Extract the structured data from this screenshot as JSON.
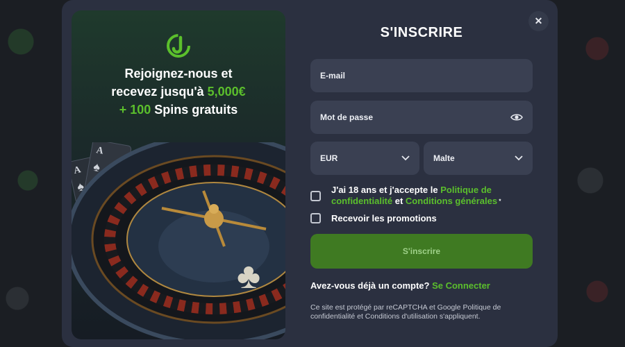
{
  "dialog": {
    "title": "S'INSCRIRE",
    "close_icon": "close-icon"
  },
  "promo": {
    "line1": "Rejoignez-nous et",
    "line2_prefix": "recevez jusqu'à ",
    "line2_amount": "5,000€",
    "line3_prefix": "+ 100",
    "line3_suffix": " Spins gratuits",
    "logo": "brand-logo"
  },
  "form": {
    "email_placeholder": "E-mail",
    "password_placeholder": "Mot de passe",
    "show_password_icon": "eye-icon",
    "currency": "EUR",
    "country": "Malte",
    "terms_prefix": "J'ai 18 ans et j'accepte le ",
    "terms_privacy_link": "Politique de confidentialité",
    "terms_and": " et ",
    "terms_conditions_link": "Conditions générales",
    "terms_required": " *",
    "promotions_label": "Recevoir les promotions",
    "submit_label": "S'inscrire",
    "login_prompt": "Avez-vous déjà un compte?",
    "login_link": "Se Connecter",
    "recaptcha_notice": "Ce site est protégé par reCAPTCHA et Google Politique de confidentialité et Conditions d'utilisation s'appliquent."
  },
  "colors": {
    "accent": "#5bbf2c",
    "modal_bg": "#2b3040",
    "field_bg": "#3a4052",
    "submit_bg": "#3f7a22"
  }
}
